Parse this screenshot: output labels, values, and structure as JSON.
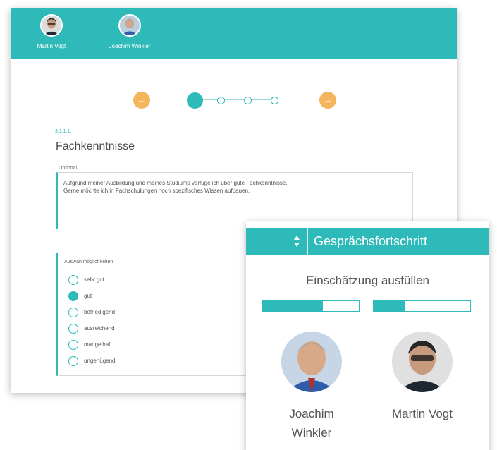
{
  "header": {
    "persons": [
      {
        "name": "Martin Vogt",
        "avatar_icon": "avatar-icon"
      },
      {
        "name": "Joachim Winkler",
        "avatar_icon": "avatar-icon"
      }
    ]
  },
  "stepper": {
    "prev_icon": "arrow-left-icon",
    "next_icon": "arrow-right-icon",
    "prev_glyph": "←",
    "next_glyph": "→",
    "steps": 4,
    "current_step": 1
  },
  "section": {
    "number": "3.1.1.1.",
    "title": "Fachkenntnisse"
  },
  "comment": {
    "label": "Optional",
    "lines": [
      "Aufgrund meiner Ausbildung und meines Studiums verfüge ich über gute Fachkenntnisse.",
      "Gerne möchte ich in Fachschulungen noch spezifisches Wissen aufbauen."
    ]
  },
  "choices": {
    "title": "Auswahlmöglichkeiten",
    "options": [
      "sehr gut",
      "gut",
      "befriedigend",
      "ausreichend",
      "mangelhaft",
      "ungenügend"
    ],
    "selected": "gut"
  },
  "progress_panel": {
    "title": "Gesprächsfortschritt",
    "subtitle": "Einschätzung ausfüllen",
    "bars": [
      0.63,
      0.32
    ],
    "persons": [
      {
        "name": "Joachim Winkler"
      },
      {
        "name": "Martin Vogt"
      }
    ]
  },
  "colors": {
    "accent": "#2dbab8",
    "arrow": "#f5b55c"
  }
}
